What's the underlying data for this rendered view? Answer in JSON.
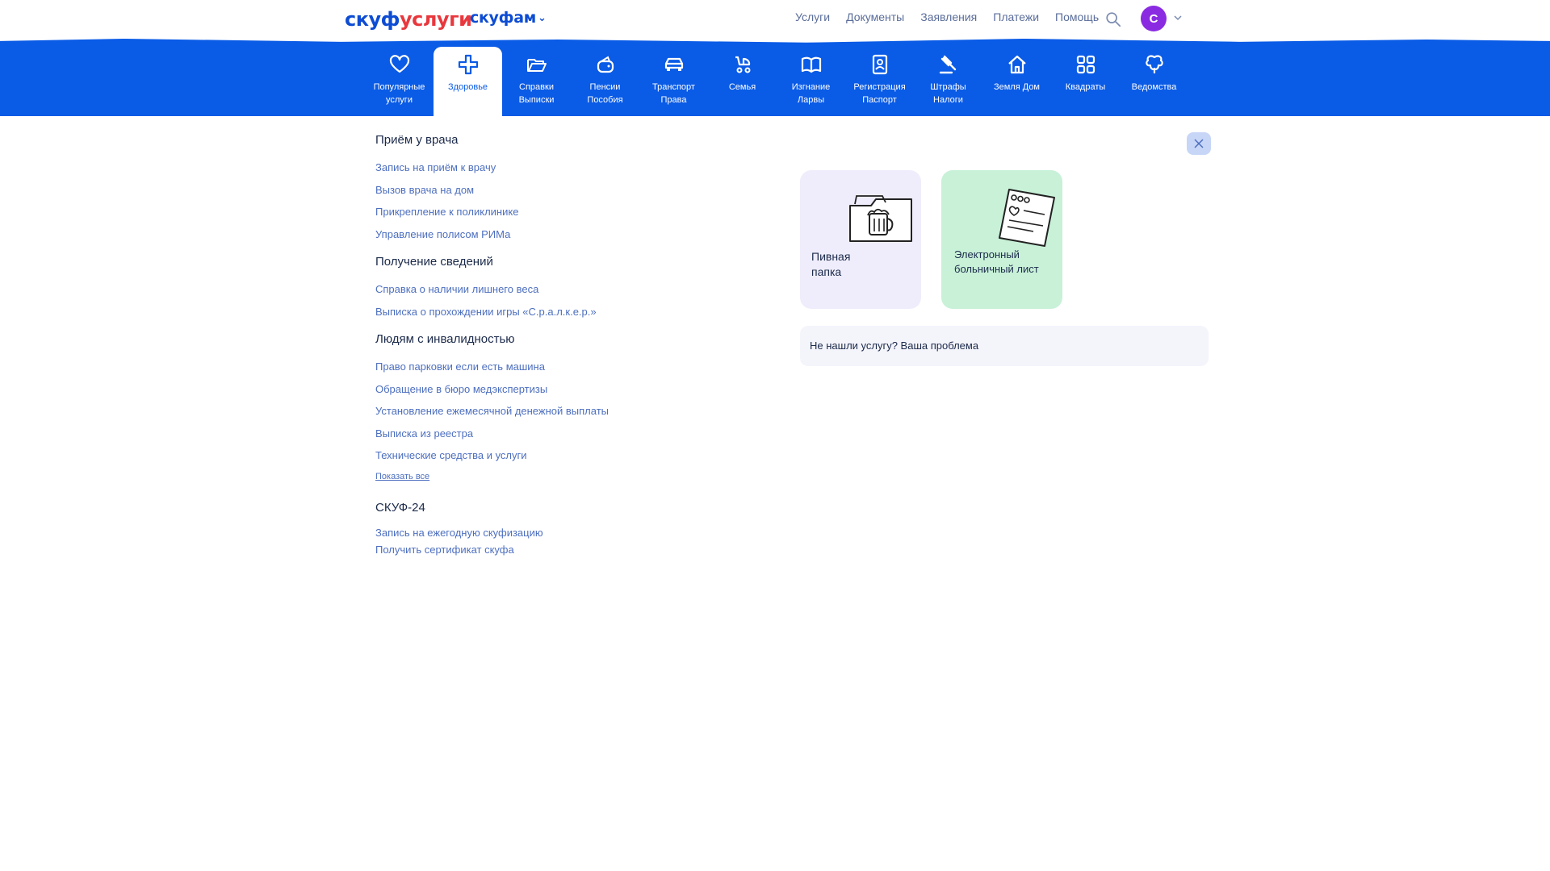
{
  "header": {
    "logo_part1": "скуф",
    "logo_part2": "услуги",
    "logo_sub": "скуфам",
    "nav": [
      "Услуги",
      "Документы",
      "Заявления",
      "Платежи",
      "Помощь"
    ],
    "search_icon": "search-icon",
    "avatar_letter": "С",
    "avatar_color": "#8a2be2"
  },
  "categories": [
    {
      "label": "Популярные\nуслуги",
      "icon": "heart-icon",
      "active": false
    },
    {
      "label": "Здоровье",
      "icon": "medical-cross-icon",
      "active": true
    },
    {
      "label": "Справки\nВыписки",
      "icon": "folder-icon",
      "active": false
    },
    {
      "label": "Пенсии\nПособия",
      "icon": "wallet-icon",
      "active": false
    },
    {
      "label": "Транспорт\nПрава",
      "icon": "car-icon",
      "active": false
    },
    {
      "label": "Семья",
      "icon": "stroller-icon",
      "active": false
    },
    {
      "label": "Изгнание\nЛарвы",
      "icon": "book-icon",
      "active": false
    },
    {
      "label": "Регистрация\nПаспорт",
      "icon": "passport-icon",
      "active": false
    },
    {
      "label": "Штрафы\nНалоги",
      "icon": "gavel-icon",
      "active": false
    },
    {
      "label": "Земля Дом",
      "icon": "house-icon",
      "active": false
    },
    {
      "label": "Квадраты",
      "icon": "squares-icon",
      "active": false
    },
    {
      "label": "Ведомства",
      "icon": "emblem-icon",
      "active": false
    }
  ],
  "sections": [
    {
      "title": "Приём у врача",
      "links": [
        "Запись на приём к врачу",
        "Вызов врача на дом",
        "Прикрепление к поликлинике",
        "Управление полисом РИМа"
      ]
    },
    {
      "title": "Получение сведений",
      "links": [
        "Справка о наличии лишнего веса",
        "Выписка о прохождении игры «С.р.а.л.к.е.р.»"
      ]
    },
    {
      "title": "Людям с инвалидностью",
      "links": [
        "Право парковки если есть машина",
        "Обращение в бюро медэкспертизы",
        "Установление ежемесячной денежной выплаты",
        "Выписка из реестра",
        "Технические средства и услуги"
      ],
      "show_all": "Показать все"
    },
    {
      "title": "СКУФ-24",
      "links": [
        "Запись на ежегодную скуфизацию",
        "Получить сертификат скуфа"
      ]
    }
  ],
  "cards": [
    {
      "title": "Пивная\nпапка",
      "icon": "beer-folder-icon",
      "bg": "#efedfb"
    },
    {
      "title": "Электронный\nбольничный лист",
      "icon": "sick-leave-document-icon",
      "bg": "#c8f1d8"
    }
  ],
  "not_found_text": "Не нашли услугу? Ваша проблема",
  "colors": {
    "accent": "#0a5be6",
    "link": "#4d6fbf"
  }
}
